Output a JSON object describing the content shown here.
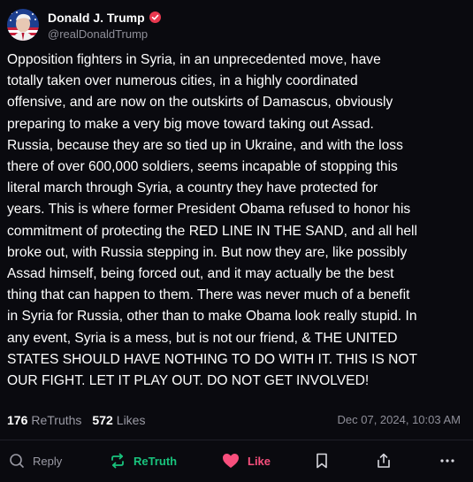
{
  "author": {
    "display_name": "Donald J. Trump",
    "handle": "@realDonaldTrump",
    "verified": true,
    "avatar_icon": "avatar-flag-portrait"
  },
  "post": {
    "text": "Opposition fighters in Syria, in an unprecedented move, have\ntotally taken over numerous cities, in a highly coordinated\noffensive, and are now on the outskirts of Damascus, obviously\npreparing to make a very big move toward taking out Assad.\nRussia, because they are so tied up in Ukraine, and with the loss\nthere of over 600,000 soldiers, seems incapable of stopping this\nliteral march through Syria, a country they have protected for\nyears. This is where former President Obama refused to honor his\ncommitment of protecting the RED LINE IN THE SAND, and all hell\nbroke out, with Russia stepping in. But now they are, like possibly\nAssad himself, being forced out, and it may actually be the best\nthing that can happen to them. There was never much of a benefit\nin Syria for Russia, other than to make Obama look really stupid. In\nany event, Syria is a mess, but is not our friend, & THE UNITED\nSTATES SHOULD HAVE NOTHING TO DO WITH IT. THIS IS NOT\nOUR FIGHT. LET IT PLAY OUT. DO NOT GET INVOLVED!"
  },
  "stats": {
    "retruths_count": "176",
    "retruths_label": "ReTruths",
    "likes_count": "572",
    "likes_label": "Likes",
    "timestamp": "Dec 07, 2024, 10:03 AM"
  },
  "actions": {
    "reply_label": "Reply",
    "retruth_label": "ReTruth",
    "like_label": "Like",
    "icons": [
      "reply-icon",
      "retruth-icon",
      "heart-icon",
      "bookmark-icon",
      "share-icon",
      "more-icon"
    ]
  },
  "colors": {
    "background": "#0a0a0f",
    "text": "#ffffff",
    "muted": "#8f8f99",
    "retruth_green": "#19c37d",
    "like_pink": "#f84f7d",
    "verified_red": "#e8384f"
  }
}
